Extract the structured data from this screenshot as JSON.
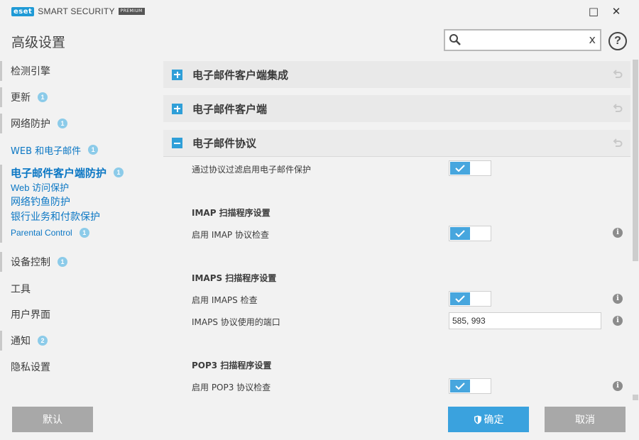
{
  "window": {
    "brand": "eset",
    "product": "SMART SECURITY",
    "edition": "PREMIUM",
    "minimize_glyph": "□",
    "close_glyph": "✕"
  },
  "header": {
    "title": "高级设置",
    "search_value": "",
    "clear_glyph": "x",
    "help_glyph": "?"
  },
  "sidebar": {
    "items": [
      {
        "label": "检测引擎",
        "badge": ""
      },
      {
        "label": "更新",
        "badge": "1"
      },
      {
        "label": "网络防护",
        "badge": "1"
      },
      {
        "label": "WEB 和电子邮件",
        "badge": "1"
      },
      {
        "label": "电子邮件客户端防护",
        "badge": "1"
      },
      {
        "label": "Web 访问保护",
        "badge": ""
      },
      {
        "label": "网络钓鱼防护",
        "badge": ""
      },
      {
        "label": "银行业务和付款保护",
        "badge": ""
      },
      {
        "label": "Parental Control",
        "badge": "1"
      },
      {
        "label": "设备控制",
        "badge": "1"
      },
      {
        "label": "工具",
        "badge": ""
      },
      {
        "label": "用户界面",
        "badge": ""
      },
      {
        "label": "通知",
        "badge": "2"
      },
      {
        "label": "隐私设置",
        "badge": ""
      }
    ]
  },
  "sections": [
    {
      "title": "电子邮件客户端集成",
      "expanded": false
    },
    {
      "title": "电子邮件客户端",
      "expanded": false
    },
    {
      "title": "电子邮件协议",
      "expanded": true
    }
  ],
  "protocol": {
    "filter_label": "通过协议过滤启用电子邮件保护",
    "filter_enabled": true,
    "imap_heading": "IMAP 扫描程序设置",
    "imap_check_label": "启用 IMAP 协议检查",
    "imap_check_enabled": true,
    "imaps_heading": "IMAPS 扫描程序设置",
    "imaps_check_label": "启用 IMAPS 检查",
    "imaps_check_enabled": true,
    "imaps_ports_label": "IMAPS 协议使用的端口",
    "imaps_ports_value": "585, 993",
    "pop3_heading": "POP3 扫描程序设置",
    "pop3_check_label": "启用 POP3 协议检查",
    "pop3_check_enabled": true,
    "info_glyph": "i"
  },
  "buttons": {
    "default": "默认",
    "ok": "确定",
    "cancel": "取消"
  },
  "colors": {
    "accent": "#3aa2de",
    "link": "#0b77c4",
    "badge": "#8ccbe9",
    "button_gray": "#a8a8a8"
  }
}
